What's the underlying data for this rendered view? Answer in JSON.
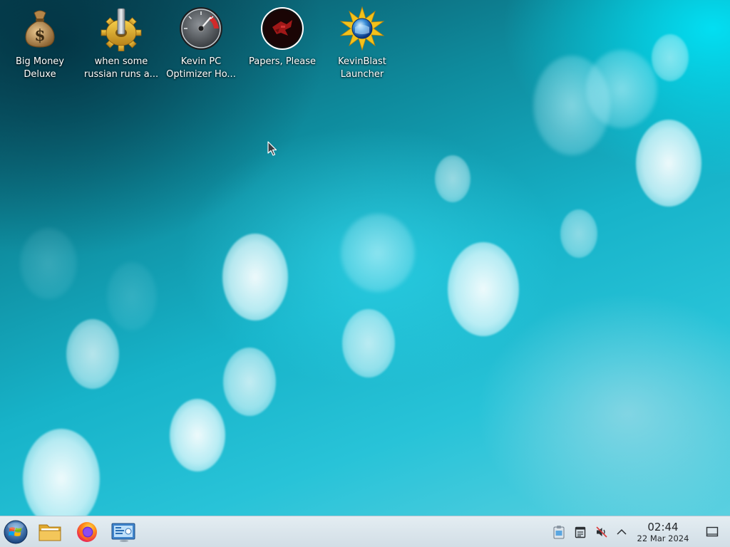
{
  "desktop": {
    "icons": [
      {
        "line1": "Big Money",
        "line2": "Deluxe",
        "icon": "money-bag-icon"
      },
      {
        "line1": "when some",
        "line2": "russian runs a...",
        "icon": "gear-icon"
      },
      {
        "line1": "Kevin PC",
        "line2": "Optimizer Ho...",
        "icon": "speedometer-icon"
      },
      {
        "line1": "Papers, Please",
        "line2": "",
        "icon": "papers-please-icon"
      },
      {
        "line1": "KevinBlast",
        "line2": "Launcher",
        "icon": "kevinblast-icon"
      }
    ]
  },
  "taskbar": {
    "launcher": {
      "icon": "start-orb-icon"
    },
    "pinned": [
      {
        "icon": "file-manager-icon"
      },
      {
        "icon": "firefox-icon"
      },
      {
        "icon": "system-settings-icon"
      }
    ],
    "tray": [
      {
        "icon": "clipboard-icon"
      },
      {
        "icon": "notes-icon"
      },
      {
        "icon": "volume-muted-icon"
      },
      {
        "icon": "chevron-up-icon"
      }
    ],
    "clock": {
      "time": "02:44",
      "date": "22 Mar 2024"
    },
    "show_desktop": {
      "icon": "show-desktop-icon"
    }
  }
}
